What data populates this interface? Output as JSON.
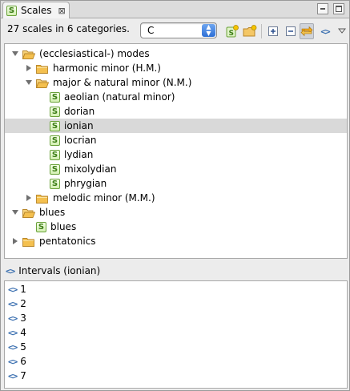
{
  "tab": {
    "title": "Scales",
    "close_glyph": "⊠"
  },
  "toolbar": {
    "count_text": "27 scales in 6 categories.",
    "key_value": "C",
    "buttons": [
      "new-scale-icon",
      "new-folder-icon",
      "expand-all-icon",
      "collapse-all-icon",
      "link-with-editor-icon",
      "show-intervals-icon"
    ]
  },
  "tree": {
    "items": [
      {
        "label": "(ecclesiastical-) modes",
        "type": "folder",
        "expanded": true,
        "depth": 0
      },
      {
        "label": "harmonic minor (H.M.)",
        "type": "folder",
        "expanded": false,
        "depth": 1
      },
      {
        "label": "major & natural minor (N.M.)",
        "type": "folder",
        "expanded": true,
        "depth": 1
      },
      {
        "label": "aeolian (natural minor)",
        "type": "scale",
        "depth": 2
      },
      {
        "label": "dorian",
        "type": "scale",
        "depth": 2
      },
      {
        "label": "ionian",
        "type": "scale",
        "depth": 2,
        "selected": true
      },
      {
        "label": "locrian",
        "type": "scale",
        "depth": 2
      },
      {
        "label": "lydian",
        "type": "scale",
        "depth": 2
      },
      {
        "label": "mixolydian",
        "type": "scale",
        "depth": 2
      },
      {
        "label": "phrygian",
        "type": "scale",
        "depth": 2
      },
      {
        "label": "melodic minor (M.M.)",
        "type": "folder",
        "expanded": false,
        "depth": 1
      },
      {
        "label": "blues",
        "type": "folder",
        "expanded": true,
        "depth": 0
      },
      {
        "label": "blues",
        "type": "scale",
        "depth": 1
      },
      {
        "label": "pentatonics",
        "type": "folder",
        "expanded": false,
        "depth": 0
      }
    ]
  },
  "intervals": {
    "title": "Intervals (ionian)",
    "items": [
      "1",
      "2",
      "3",
      "4",
      "5",
      "6",
      "7"
    ]
  },
  "colors": {
    "accent": "#2d6fd6",
    "scale_icon": "#6aa23a",
    "selection": "#d9d9d9"
  }
}
